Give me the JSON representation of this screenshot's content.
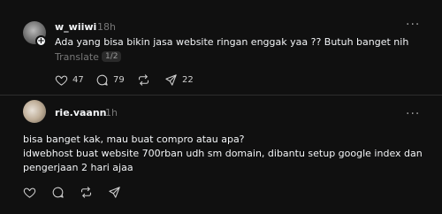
{
  "post": {
    "username": "w_wiiwi",
    "time": "18h",
    "text": "Ada yang bisa bikin jasa website ringan enggak yaa ?? Butuh banget nih",
    "translate_label": "Translate",
    "page_indicator": "1/2",
    "actions": {
      "likes": "47",
      "replies": "79",
      "reposts": "",
      "shares": "22"
    },
    "icons": [
      "heart-icon",
      "comment-icon",
      "repost-icon",
      "share-icon",
      "more-icon"
    ]
  },
  "reply": {
    "username": "rie.vaann",
    "time": "1h",
    "text_line1": "bisa banget kak, mau buat compro atau apa?",
    "text_line2": "idwebhost buat website 700rban udh sm domain, dibantu setup google index dan",
    "text_line3": "pengerjaan 2 hari ajaa",
    "icons": [
      "heart-icon",
      "comment-icon",
      "repost-icon",
      "share-icon",
      "more-icon"
    ]
  },
  "colors": {
    "background": "#101010",
    "text": "#f3f5f7",
    "secondary": "#777777",
    "divider": "#2d2d2d"
  }
}
